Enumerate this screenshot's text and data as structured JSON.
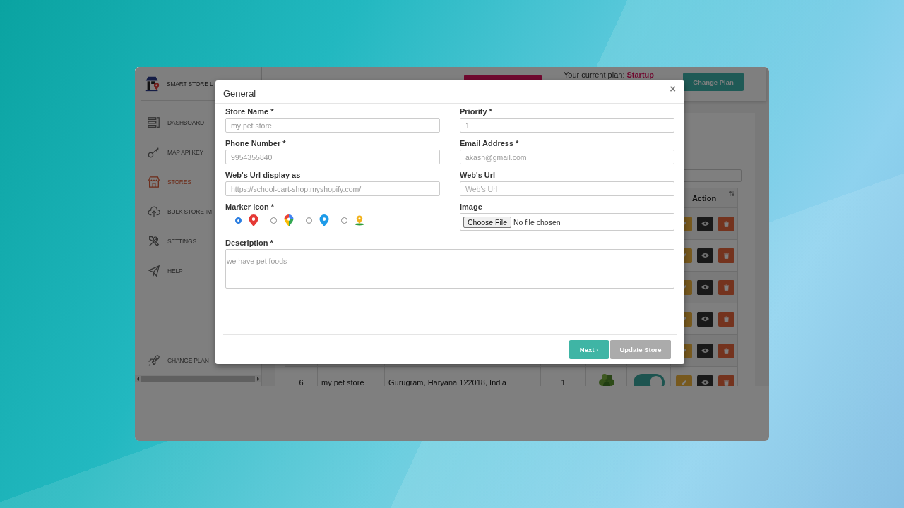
{
  "sidebar": {
    "brand": "SMART STORE L",
    "items": [
      {
        "kind": "bars",
        "label": "DASHBOARD",
        "selected": false
      },
      {
        "kind": "key",
        "label": "MAP API KEY",
        "selected": false
      },
      {
        "kind": "store",
        "label": "STORES",
        "selected": true
      },
      {
        "kind": "upload",
        "label": "BULK STORE IM",
        "selected": false
      },
      {
        "kind": "tools",
        "label": "SETTINGS",
        "selected": false
      },
      {
        "kind": "plane",
        "label": "HELP",
        "selected": false
      }
    ],
    "footer_item": {
      "kind": "rocket",
      "label": "CHANGE PLAN",
      "selected": false
    }
  },
  "header": {
    "plan_label": "Your current plan:",
    "plan_name": "Startup",
    "change_plan_button": "Change Plan"
  },
  "table": {
    "action_column": "Action",
    "rows": [
      {
        "kind": "covered"
      },
      {
        "kind": "covered"
      },
      {
        "kind": "covered"
      },
      {
        "kind": "covered"
      },
      {
        "kind": "covered"
      },
      {
        "kind": "full",
        "number": "6",
        "name": "my pet store",
        "address": "Gurugram, Haryana 122018, India",
        "priority": "1",
        "status_on": true
      }
    ]
  },
  "modal": {
    "title": "General",
    "close": "×",
    "fields": [
      {
        "kind": "text",
        "label": "Store Name *",
        "value": "my pet store"
      },
      {
        "kind": "text",
        "label": "Priority *",
        "value": "1"
      },
      {
        "kind": "text",
        "label": "Phone Number *",
        "value": "9954355840"
      },
      {
        "kind": "text",
        "label": "Email Address *",
        "value": "akash@gmail.com"
      },
      {
        "kind": "text",
        "label": "Web's Url display as",
        "value": "https://school-cart-shop.myshopify.com/"
      },
      {
        "kind": "text",
        "label": "Web's Url",
        "placeholder": "Web's Url"
      },
      {
        "kind": "markers",
        "label": "Marker Icon *",
        "options": [
          {
            "kind": "red",
            "selected": true
          },
          {
            "kind": "multicolor",
            "selected": false
          },
          {
            "kind": "blue",
            "selected": false
          },
          {
            "kind": "person",
            "selected": false
          }
        ]
      },
      {
        "kind": "file",
        "label": "Image",
        "button": "Choose File",
        "status": "No file chosen"
      }
    ],
    "description": {
      "label": "Description *",
      "value": "we have pet foods"
    },
    "buttons": [
      {
        "label": "Next ›",
        "disabled": false
      },
      {
        "label": "Update Store",
        "disabled": true
      }
    ]
  }
}
